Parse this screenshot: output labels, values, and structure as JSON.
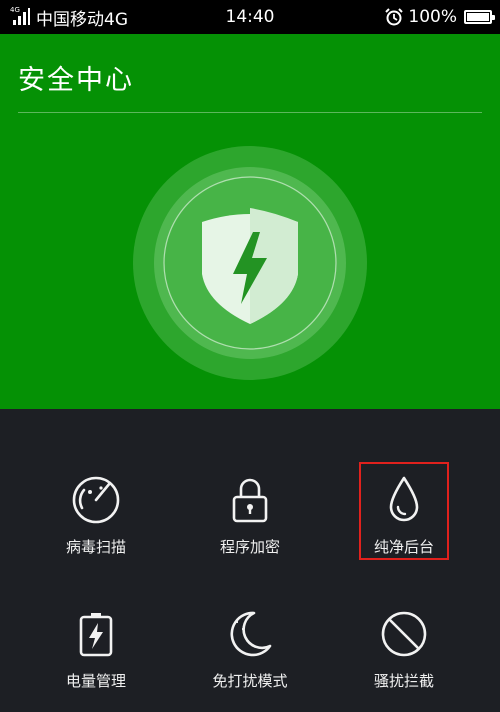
{
  "status_bar": {
    "network_type": "4G",
    "carrier": "中国移动4G",
    "time": "14:40",
    "battery": "100%",
    "battery_level": 1.0,
    "icons": [
      "signal-icon",
      "alarm-icon",
      "battery-icon"
    ]
  },
  "header": {
    "title": "安全中心"
  },
  "hero": {
    "icon": "shield-lightning-icon",
    "background_color": "#059105"
  },
  "features": [
    {
      "label": "病毒扫描",
      "icon": "radar-scan-icon"
    },
    {
      "label": "程序加密",
      "icon": "padlock-icon"
    },
    {
      "label": "纯净后台",
      "icon": "water-drop-icon",
      "highlighted": true
    },
    {
      "label": "电量管理",
      "icon": "battery-bolt-icon"
    },
    {
      "label": "免打扰模式",
      "icon": "moon-stars-icon"
    },
    {
      "label": "骚扰拦截",
      "icon": "block-icon"
    }
  ],
  "colors": {
    "accent_green": "#059105",
    "panel_background": "#1d1f24",
    "highlight_red": "#e0211d"
  }
}
